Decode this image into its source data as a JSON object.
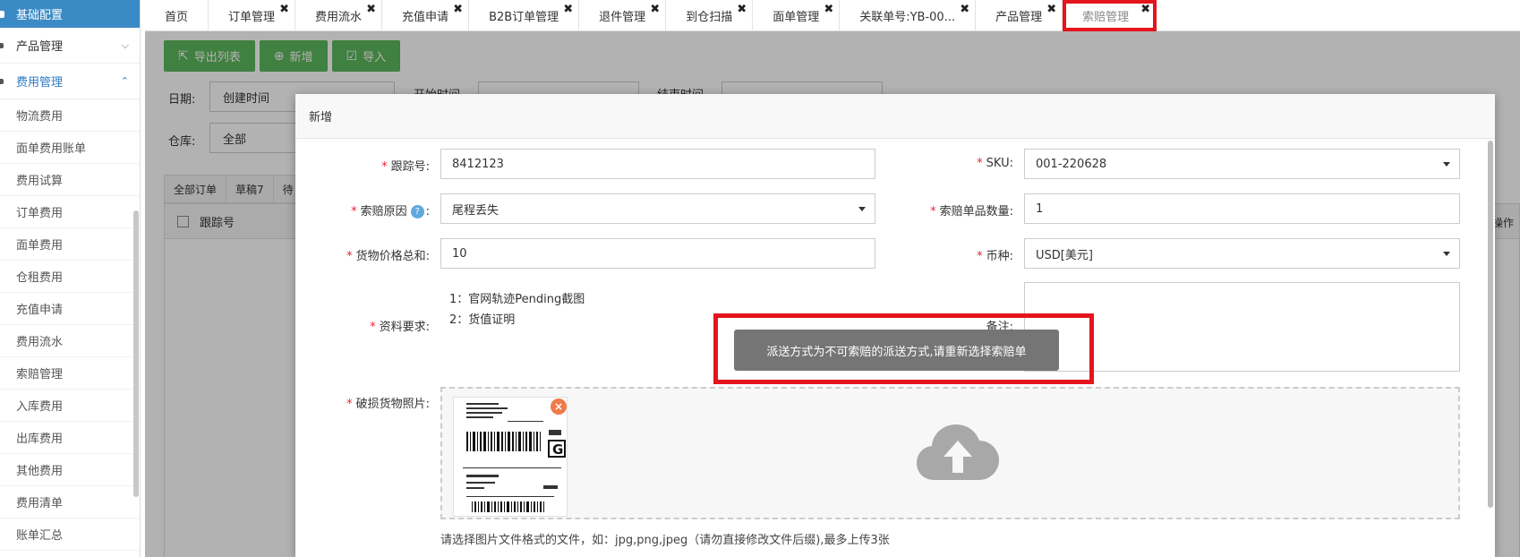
{
  "sidebar": {
    "header": "基础配置",
    "groups": [
      {
        "label": "产品管理",
        "chevron": "⌵"
      },
      {
        "label": "费用管理",
        "chevron": "⌃"
      }
    ],
    "items": [
      "物流费用",
      "面单费用账单",
      "费用试算",
      "订单费用",
      "面单费用",
      "仓租费用",
      "充值申请",
      "费用流水",
      "索赔管理",
      "入库费用",
      "出库费用",
      "其他费用",
      "费用清单",
      "账单汇总"
    ]
  },
  "tabs": [
    "首页",
    "订单管理",
    "费用流水",
    "充值申请",
    "B2B订单管理",
    "退件管理",
    "到仓扫描",
    "面单管理",
    "关联单号:YB-00...",
    "产品管理",
    "索赔管理"
  ],
  "toolbar": {
    "export": "导出列表",
    "add": "新增",
    "import": "导入"
  },
  "filters": {
    "date_label": "日期:",
    "date_value": "创建时间",
    "start_label": "开始时间",
    "end_label": "结束时间",
    "warehouse_label": "仓库:",
    "warehouse_value": "全部"
  },
  "subtabs": [
    "全部订单",
    "草稿7",
    "待"
  ],
  "grid": {
    "col_tracking": "跟踪号",
    "col_op": "操作"
  },
  "modal": {
    "title": "新增",
    "tracking_label": "跟踪号:",
    "tracking_value": "8412123",
    "sku_label": "SKU:",
    "sku_value": "001-220628",
    "reason_label": "索赔原因",
    "reason_help": "?",
    "reason_value": "尾程丢失",
    "qty_label": "索赔单品数量:",
    "qty_value": "1",
    "price_label": "货物价格总和:",
    "price_value": "10",
    "currency_label": "币种:",
    "currency_value": "USD[美元]",
    "docs_label": "资料要求:",
    "docs_items": [
      "1：官网轨迹Pending截图",
      "2：货值证明"
    ],
    "remark_label": "备注:",
    "photo_label": "破损货物照片:",
    "upload_hint": "请选择图片文件格式的文件，如：jpg,png,jpeg（请勿直接修改文件后缀),最多上传3张",
    "thumb_del": "×"
  },
  "toast": "派送方式为不可索赔的派送方式,请重新选择索赔单",
  "colors": {
    "accent": "#3a8ac5",
    "green": "#5cb85c",
    "highlight": "#e5141d",
    "cloud": "#a8a8a8"
  }
}
